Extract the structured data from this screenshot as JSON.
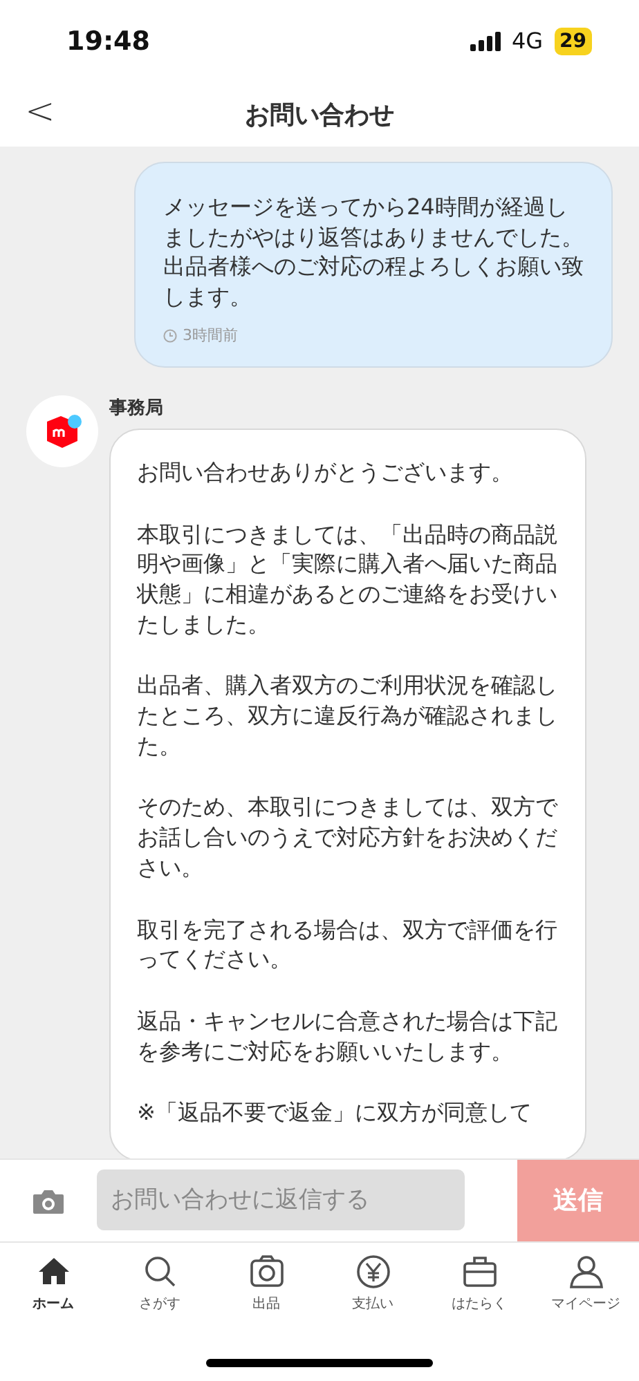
{
  "status_bar": {
    "time": "19:48",
    "network": "4G",
    "battery": "29"
  },
  "header": {
    "back": "<",
    "title": "お問い合わせ"
  },
  "messages": [
    {
      "kind": "outgoing",
      "paragraphs": [
        "メッセージを送ってから24時間が経過しましたがやはり返答はありませんでした。出品者様へのご対応の程よろしくお願い致します。"
      ],
      "time": "3時間前"
    },
    {
      "kind": "incoming",
      "sender": "事務局",
      "paragraphs": [
        "お問い合わせありがとうございます。",
        "本取引につきましては、「出品時の商品説明や画像」と「実際に購入者へ届いた商品状態」に相違があるとのご連絡をお受けいたしました。",
        "出品者、購入者双方のご利用状況を確認したところ、双方に違反行為が確認されました。",
        "そのため、本取引につきましては、双方でお話し合いのうえで対応方針をお決めください。",
        "取引を完了される場合は、双方で評価を行ってください。",
        "返品・キャンセルに合意された場合は下記を参考にご対応をお願いいたします。",
        "※「返品不要で返金」に双方が同意して"
      ]
    }
  ],
  "composer": {
    "placeholder": "お問い合わせに返信する",
    "send": "送信"
  },
  "tabs": [
    {
      "label": "ホーム",
      "selected": true
    },
    {
      "label": "さがす",
      "selected": false
    },
    {
      "label": "出品",
      "selected": false
    },
    {
      "label": "支払い",
      "selected": false
    },
    {
      "label": "はたらく",
      "selected": false
    },
    {
      "label": "マイページ",
      "selected": false
    }
  ]
}
